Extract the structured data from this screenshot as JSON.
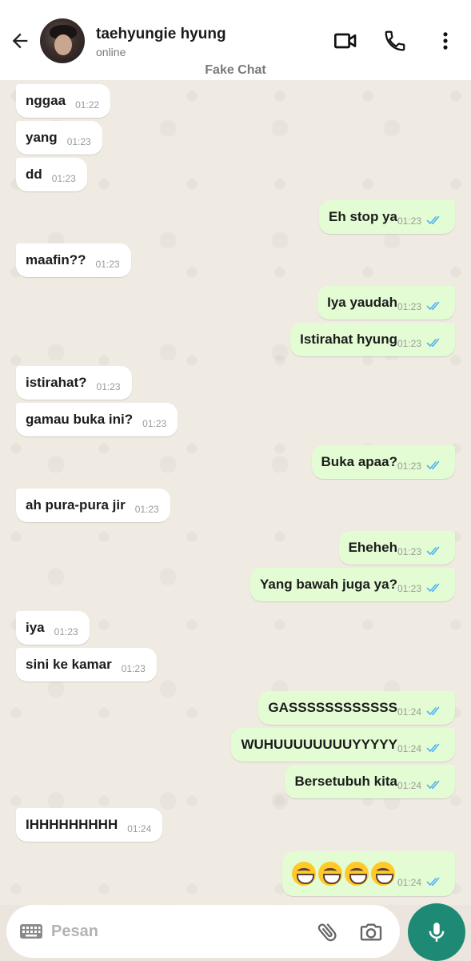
{
  "header": {
    "contact_name": "taehyungie hyung",
    "status": "online",
    "watermark": "Fake Chat"
  },
  "messages": [
    {
      "dir": "in",
      "text": "nggaa",
      "time": "01:22"
    },
    {
      "dir": "in",
      "text": "yang",
      "time": "01:23"
    },
    {
      "dir": "in",
      "text": "dd",
      "time": "01:23"
    },
    {
      "dir": "out",
      "text": "Eh stop ya",
      "time": "01:23",
      "read": true
    },
    {
      "dir": "in",
      "text": "maafin??",
      "time": "01:23"
    },
    {
      "dir": "out",
      "text": "Iya yaudah",
      "time": "01:23",
      "read": true
    },
    {
      "dir": "out",
      "text": "Istirahat hyung",
      "time": "01:23",
      "read": true
    },
    {
      "dir": "in",
      "text": "istirahat?",
      "time": "01:23"
    },
    {
      "dir": "in",
      "text": "gamau buka ini?",
      "time": "01:23"
    },
    {
      "dir": "out",
      "text": "Buka apaa?",
      "time": "01:23",
      "read": true
    },
    {
      "dir": "in",
      "text": "ah pura-pura jir",
      "time": "01:23"
    },
    {
      "dir": "out",
      "text": "Eheheh",
      "time": "01:23",
      "read": true
    },
    {
      "dir": "out",
      "text": "Yang bawah juga ya?",
      "time": "01:23",
      "read": true
    },
    {
      "dir": "in",
      "text": "iya",
      "time": "01:23"
    },
    {
      "dir": "in",
      "text": "sini ke kamar",
      "time": "01:23"
    },
    {
      "dir": "out",
      "text": "GASSSSSSSSSSSS",
      "time": "01:24",
      "read": true
    },
    {
      "dir": "out",
      "text": "WUHUUUUUUUUYYYYY",
      "time": "01:24",
      "read": true
    },
    {
      "dir": "out",
      "text": "Bersetubuh kita",
      "time": "01:24",
      "read": true
    },
    {
      "dir": "in",
      "text": "IHHHHHHHHH",
      "time": "01:24"
    },
    {
      "dir": "out",
      "text": "",
      "emoji": [
        "grinning-face-icon",
        "grinning-face-icon",
        "grinning-face-icon",
        "grinning-face-icon"
      ],
      "time": "01:24",
      "read": true
    }
  ],
  "composer": {
    "placeholder": "Pesan"
  },
  "colors": {
    "incoming_bubble": "#ffffff",
    "outgoing_bubble": "#e3fcd4",
    "read_ticks": "#4fb3f0",
    "mic_button": "#1e8a75",
    "chat_background": "#efeae2"
  },
  "icons": {
    "back": "arrow-left-icon",
    "video": "video-camera-icon",
    "call": "phone-icon",
    "more": "more-vertical-icon",
    "keyboard": "keyboard-icon",
    "attach": "paperclip-icon",
    "camera": "camera-icon",
    "mic": "microphone-icon"
  }
}
